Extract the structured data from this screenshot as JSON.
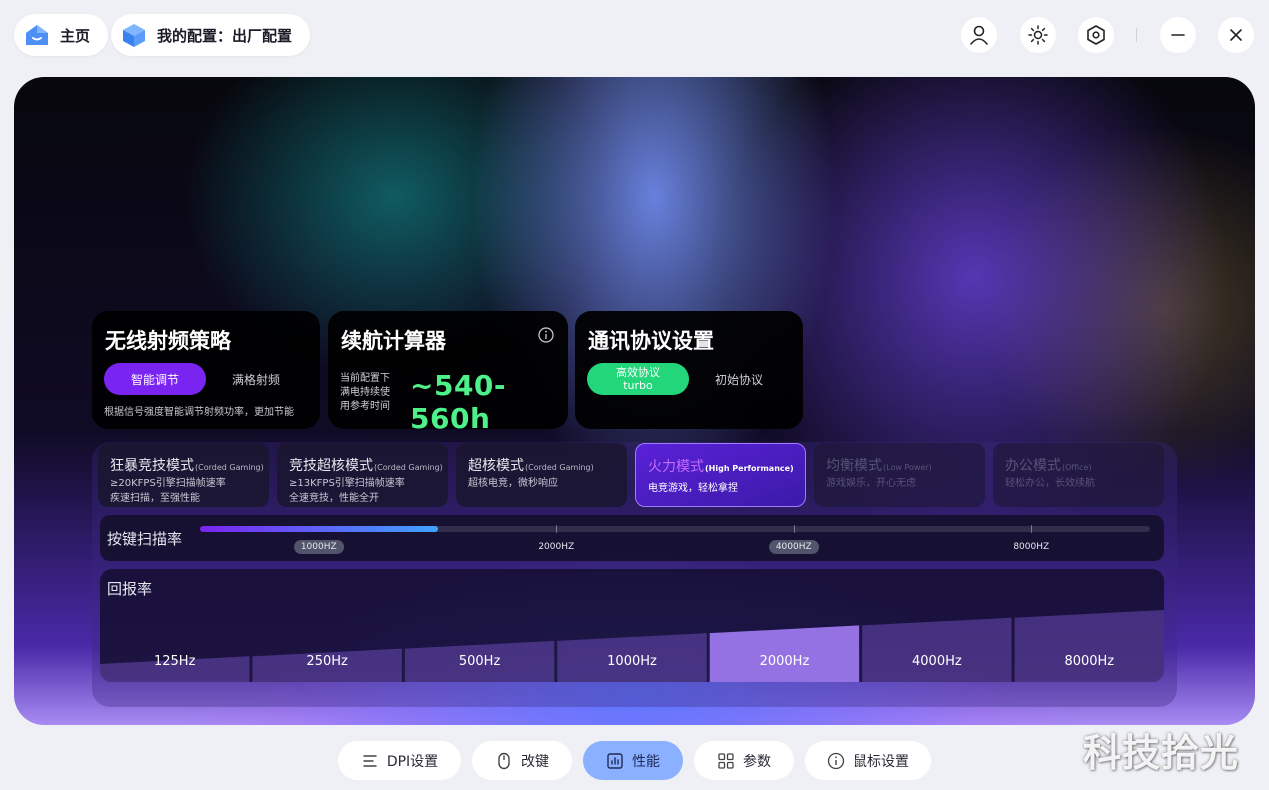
{
  "header": {
    "home_label": "主页",
    "config_label": "我的配置：出厂配置"
  },
  "rf_card": {
    "title": "无线射频策略",
    "primary": "智能调节",
    "secondary": "满格射频",
    "desc": "根据信号强度智能调节射频功率，更加节能"
  },
  "battery_card": {
    "title": "续航计算器",
    "line1": "当前配置下",
    "line2": "满电持续使",
    "line3": "用参考时间",
    "value": "~540-560h"
  },
  "protocol_card": {
    "title": "通讯协议设置",
    "primary_line1": "高效协议",
    "primary_line2": "turbo",
    "secondary": "初始协议"
  },
  "modes": [
    {
      "title": "狂暴竞技模式",
      "tag": "(Corded Gaming)",
      "line1": "≥20KFPS引擎扫描帧速率",
      "line2": "疾速扫描，至强性能",
      "state": "normal"
    },
    {
      "title": "竞技超核模式",
      "tag": "(Corded Gaming)",
      "line1": "≥13KFPS引擎扫描帧速率",
      "line2": "全速竞技，性能全开",
      "state": "normal"
    },
    {
      "title": "超核模式",
      "tag": "(Corded Gaming)",
      "line1": "超核电竞，微秒响应",
      "line2": "",
      "state": "normal"
    },
    {
      "title": "火力模式",
      "tag": "(High Performance)",
      "line1": "电竞游戏，轻松拿捏",
      "line2": "",
      "state": "active"
    },
    {
      "title": "均衡模式",
      "tag": "(Low Power)",
      "line1": "游戏娱乐，开心无虑",
      "line2": "",
      "state": "dim"
    },
    {
      "title": "办公模式",
      "tag": "(Office)",
      "line1": "轻松办公，长效续航",
      "line2": "",
      "state": "dim"
    }
  ],
  "scan_rate": {
    "label": "按键扫描率",
    "options": [
      "1000HZ",
      "2000HZ",
      "4000HZ",
      "8000HZ"
    ],
    "selected": "1000HZ",
    "highlighted": "4000HZ"
  },
  "report_rate": {
    "label": "回报率",
    "options": [
      "125Hz",
      "250Hz",
      "500Hz",
      "1000Hz",
      "2000Hz",
      "4000Hz",
      "8000Hz"
    ],
    "selected": "2000Hz"
  },
  "nav": {
    "tabs": [
      "DPI设置",
      "改键",
      "性能",
      "参数",
      "鼠标设置"
    ],
    "active": "性能"
  },
  "watermark": "科技拾光"
}
